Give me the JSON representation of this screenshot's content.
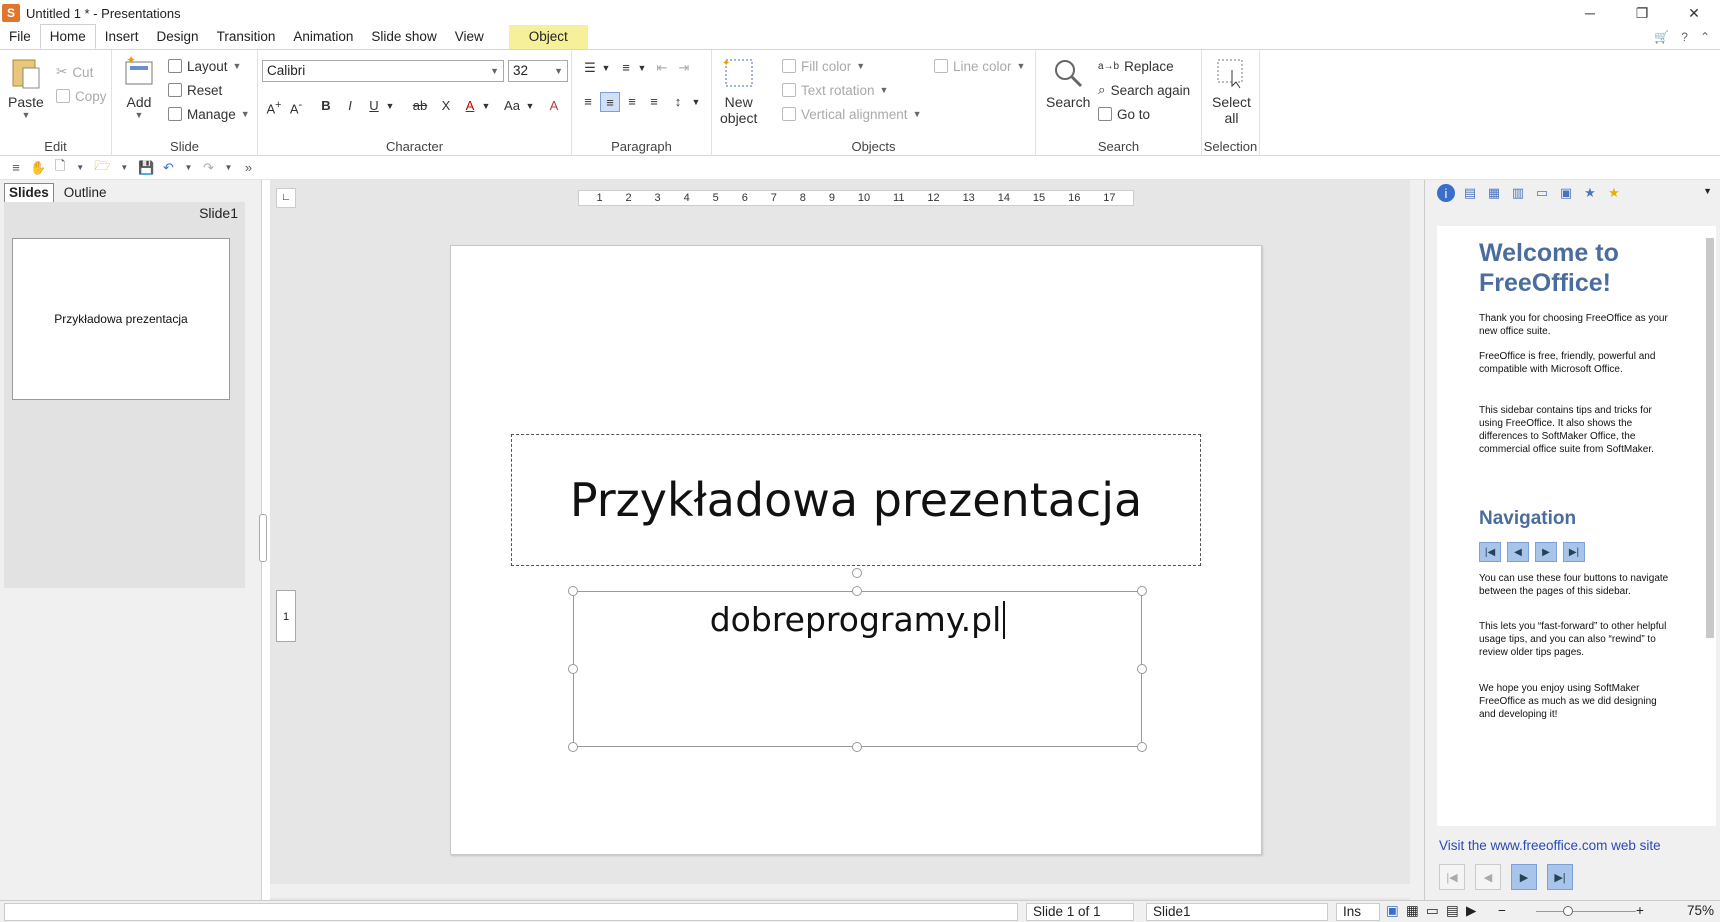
{
  "window": {
    "title": "Untitled 1 * - Presentations",
    "app_icon": "S"
  },
  "menu": [
    "File",
    "Home",
    "Insert",
    "Design",
    "Transition",
    "Animation",
    "Slide show",
    "View"
  ],
  "menu_object": "Object",
  "ribbon": {
    "edit": {
      "label": "Edit",
      "paste": "Paste",
      "cut": "Cut",
      "copy": "Copy"
    },
    "slide": {
      "label": "Slide",
      "add": "Add",
      "layout": "Layout",
      "reset": "Reset",
      "manage": "Manage"
    },
    "character": {
      "label": "Character",
      "font": "Calibri",
      "size": "32"
    },
    "paragraph": {
      "label": "Paragraph"
    },
    "objects": {
      "label": "Objects",
      "new_object_1": "New",
      "new_object_2": "object",
      "fill_color": "Fill color",
      "line_color": "Line color",
      "text_rotation": "Text rotation",
      "vertical_alignment": "Vertical alignment"
    },
    "search": {
      "label": "Search",
      "search": "Search",
      "replace": "Replace",
      "search_again": "Search again",
      "go_to": "Go to"
    },
    "selection": {
      "label": "Selection",
      "select_all_1": "Select",
      "select_all_2": "all"
    }
  },
  "left_panel": {
    "tabs": [
      "Slides",
      "Outline"
    ],
    "slide_label": "Slide1",
    "thumbnail_title": "Przykładowa prezentacja"
  },
  "ruler": [
    "1",
    "2",
    "3",
    "4",
    "5",
    "6",
    "7",
    "8",
    "9",
    "10",
    "11",
    "12",
    "13",
    "14",
    "15",
    "16",
    "17"
  ],
  "vruler": "1",
  "slide": {
    "title": "Przykładowa prezentacja",
    "subtitle": "dobreprogramy.pl"
  },
  "sidebar": {
    "heading": "Welcome to FreeOffice!",
    "p1": "Thank you for choosing FreeOffice as your new office suite.",
    "p2": "FreeOffice is free, friendly, powerful and compatible with Microsoft Office.",
    "p3": "This sidebar contains tips and tricks for using FreeOffice. It also shows the differences to SoftMaker Office, the commercial office suite from SoftMaker.",
    "nav_heading": "Navigation",
    "p4": "You can use these four buttons to navigate between the pages of this sidebar.",
    "p5": "This lets you “fast-forward” to other helpful usage tips, and you can also “rewind” to review older tips pages.",
    "p6": "We hope you enjoy using SoftMaker FreeOffice as much as we did designing and developing it!",
    "link": "Visit the www.freeoffice.com web site"
  },
  "status": {
    "slide_of": "Slide 1 of 1",
    "slide_name": "Slide1",
    "mode": "Ins",
    "zoom": "75%"
  },
  "colors": {
    "accent_object_tab": "#f6f09a",
    "sidebar_heading": "#4b6d9e",
    "link": "#2a4ab5"
  }
}
